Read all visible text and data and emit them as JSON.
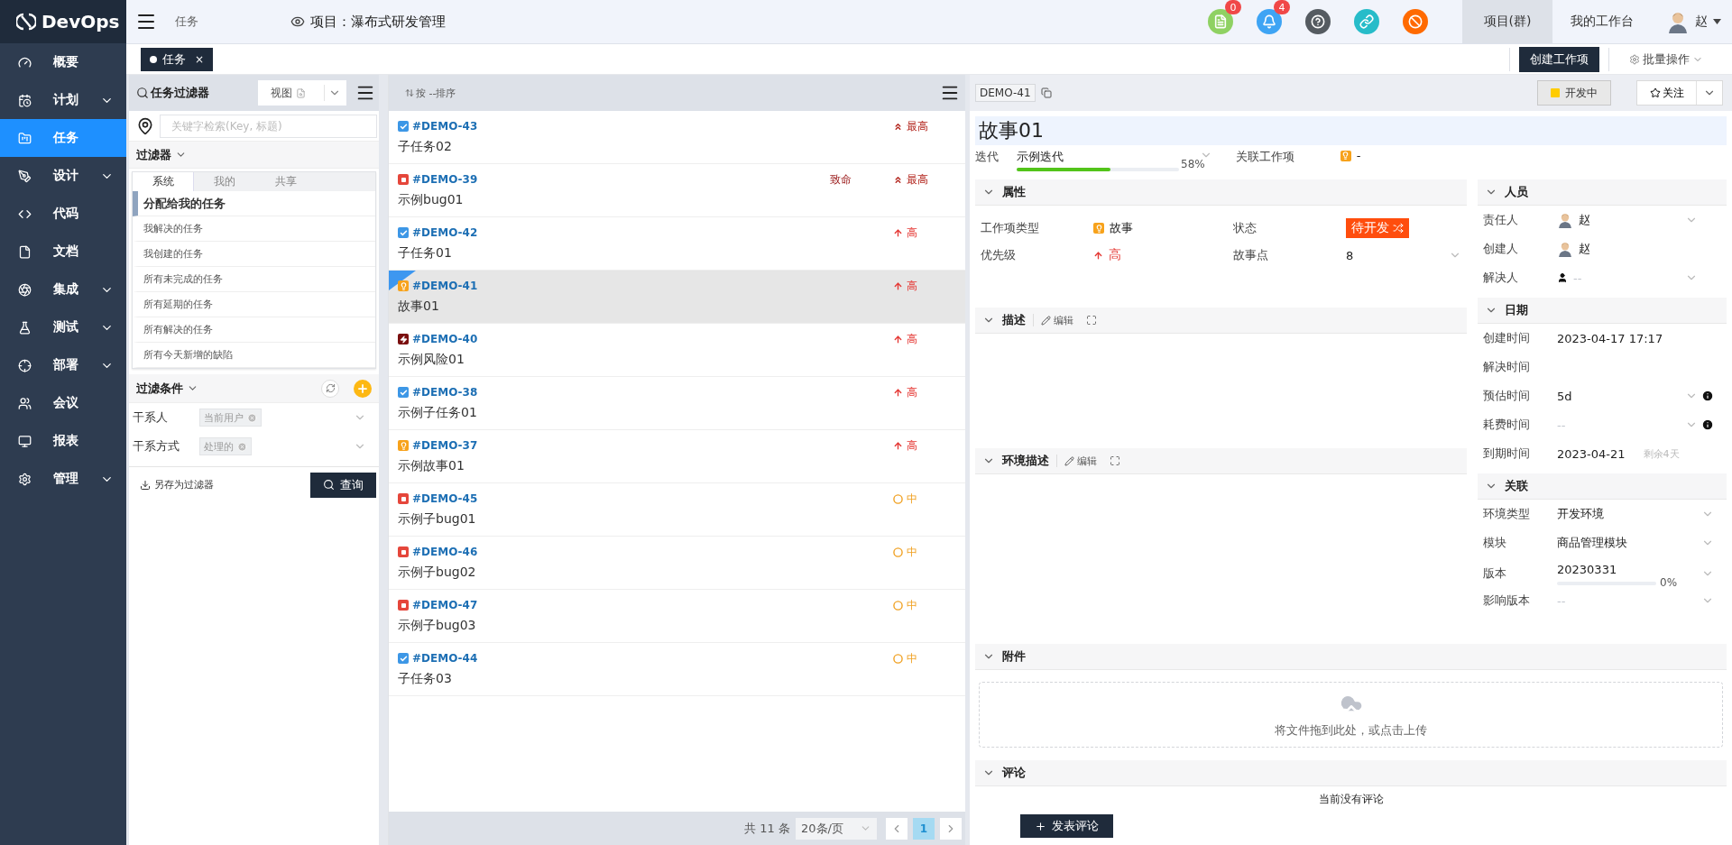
{
  "sidebar": {
    "logo": "DevOps",
    "items": [
      {
        "label": "概要",
        "selected": false,
        "expandable": false
      },
      {
        "label": "计划",
        "selected": false,
        "expandable": true
      },
      {
        "label": "任务",
        "selected": true,
        "expandable": false
      },
      {
        "label": "设计",
        "selected": false,
        "expandable": true
      },
      {
        "label": "代码",
        "selected": false,
        "expandable": false
      },
      {
        "label": "文档",
        "selected": false,
        "expandable": false
      },
      {
        "label": "集成",
        "selected": false,
        "expandable": true
      },
      {
        "label": "测试",
        "selected": false,
        "expandable": true
      },
      {
        "label": "部署",
        "selected": false,
        "expandable": true
      },
      {
        "label": "会议",
        "selected": false,
        "expandable": false
      },
      {
        "label": "报表",
        "selected": false,
        "expandable": false
      },
      {
        "label": "管理",
        "selected": false,
        "expandable": true
      }
    ]
  },
  "topbar": {
    "page": "任务",
    "project": "项目：瀑布式研发管理",
    "tools": [
      {
        "kind": "doc",
        "color": "#8fd163",
        "badge": "0"
      },
      {
        "kind": "bell",
        "color": "#3ea4f4",
        "badge": "4"
      },
      {
        "kind": "help",
        "color": "#555b61"
      },
      {
        "kind": "link",
        "color": "#27bcc9"
      },
      {
        "kind": "ban",
        "color": "#ff6a00"
      }
    ],
    "nav": [
      {
        "label": "项目(群)",
        "selected": true
      },
      {
        "label": "我的工作台",
        "selected": false
      }
    ],
    "user": "赵"
  },
  "tabs": [
    {
      "label": "任务",
      "selected": true,
      "close": "×"
    }
  ],
  "toolbar": {
    "create": "创建工作项",
    "batch": "批量操作"
  },
  "filter_panel": {
    "title": "任务过滤器",
    "view": "视图",
    "search": {
      "placeholder": "关键字检索(Key, 标题)"
    },
    "filters_title": "过滤器",
    "filters_expanded": true,
    "filter_tabs": [
      {
        "label": "系统",
        "selected": true
      },
      {
        "label": "我的",
        "selected": false
      },
      {
        "label": "共享",
        "selected": false
      }
    ],
    "filters": [
      {
        "label": "分配给我的任务",
        "selected": true
      },
      {
        "label": "我解决的任务",
        "selected": false
      },
      {
        "label": "我创建的任务",
        "selected": false
      },
      {
        "label": "所有未完成的任务",
        "selected": false
      },
      {
        "label": "所有延期的任务",
        "selected": false
      },
      {
        "label": "所有解决的任务",
        "selected": false
      },
      {
        "label": "所有今天新增的缺陷",
        "selected": false
      }
    ],
    "conditions_title": "过滤条件",
    "conditions_expanded": true,
    "conditions": [
      {
        "label": "干系人",
        "tag": "当前用户"
      },
      {
        "label": "干系方式",
        "tag": "处理的"
      }
    ],
    "save": "另存为过滤器",
    "query": "查询"
  },
  "list": {
    "sort": "按 --排序",
    "rows": [
      {
        "key": "#DEMO-43",
        "title": "子任务02",
        "kind": "task",
        "priority": {
          "label": "最高",
          "kind": "highest"
        },
        "selected": false
      },
      {
        "key": "#DEMO-39",
        "title": "示例bug01",
        "kind": "bug",
        "severity": "致命",
        "priority": {
          "label": "最高",
          "kind": "highest"
        },
        "selected": false
      },
      {
        "key": "#DEMO-42",
        "title": "子任务01",
        "kind": "task",
        "priority": {
          "label": "高",
          "kind": "high"
        },
        "selected": false
      },
      {
        "key": "#DEMO-41",
        "title": "故事01",
        "kind": "story",
        "priority": {
          "label": "高",
          "kind": "high"
        },
        "selected": true
      },
      {
        "key": "#DEMO-40",
        "title": "示例风险01",
        "kind": "risk",
        "priority": {
          "label": "高",
          "kind": "high"
        },
        "selected": false
      },
      {
        "key": "#DEMO-38",
        "title": "示例子任务01",
        "kind": "task",
        "priority": {
          "label": "高",
          "kind": "high"
        },
        "selected": false
      },
      {
        "key": "#DEMO-37",
        "title": "示例故事01",
        "kind": "story",
        "priority": {
          "label": "高",
          "kind": "high"
        },
        "selected": false
      },
      {
        "key": "#DEMO-45",
        "title": "示例子bug01",
        "kind": "bug",
        "priority": {
          "label": "中",
          "kind": "medium"
        },
        "selected": false
      },
      {
        "key": "#DEMO-46",
        "title": "示例子bug02",
        "kind": "bug",
        "priority": {
          "label": "中",
          "kind": "medium"
        },
        "selected": false
      },
      {
        "key": "#DEMO-47",
        "title": "示例子bug03",
        "kind": "bug",
        "priority": {
          "label": "中",
          "kind": "medium"
        },
        "selected": false
      },
      {
        "key": "#DEMO-44",
        "title": "子任务03",
        "kind": "task",
        "priority": {
          "label": "中",
          "kind": "medium"
        },
        "selected": false
      }
    ],
    "footer": {
      "total": "共 11 条",
      "page_size": "20条/页",
      "pages": [
        {
          "label": "1",
          "selected": true
        }
      ]
    }
  },
  "detail": {
    "key": "DEMO-41",
    "status": "开发中",
    "follow": "关注",
    "title": "故事01",
    "iteration": {
      "label": "迭代",
      "value": "示例迭代",
      "level": 0.58,
      "reading": "58%"
    },
    "related": {
      "label": "关联工作项",
      "value": "-"
    },
    "attributes": {
      "title": "属性",
      "expanded": true,
      "fields": [
        {
          "label": "工作项类型",
          "kind": "type",
          "value": "故事"
        },
        {
          "label": "状态",
          "kind": "status",
          "value": "待开发"
        },
        {
          "label": "优先级",
          "kind": "priority",
          "value": "高"
        },
        {
          "label": "故事点",
          "kind": "select",
          "value": "8"
        }
      ]
    },
    "description": {
      "title": "描述",
      "expanded": true,
      "edit": "编辑"
    },
    "environment": {
      "title": "环境描述",
      "expanded": true,
      "edit": "编辑"
    },
    "people": {
      "title": "人员",
      "expanded": true,
      "rows": [
        {
          "label": "责任人",
          "kind": "avatar",
          "value": "赵",
          "dropdown": true
        },
        {
          "label": "创建人",
          "kind": "avatar",
          "value": "赵",
          "dropdown": false
        },
        {
          "label": "解决人",
          "kind": "person",
          "placeholder": "--",
          "dropdown": true
        }
      ]
    },
    "dates": {
      "title": "日期",
      "expanded": true,
      "rows": [
        {
          "label": "创建时间",
          "value": "2023-04-17 17:17",
          "dropdown": false,
          "info": false
        },
        {
          "label": "解决时间",
          "dropdown": false,
          "info": false
        },
        {
          "label": "预估时间",
          "value": "5d",
          "dropdown": true,
          "info": true
        },
        {
          "label": "耗费时间",
          "placeholder": "--",
          "dropdown": true,
          "info": true
        },
        {
          "label": "到期时间",
          "value": "2023-04-21",
          "note": "剩余4天",
          "dropdown": false,
          "info": false
        }
      ]
    },
    "relations": {
      "title": "关联",
      "expanded": true,
      "rows": [
        {
          "label": "环境类型",
          "value": "开发环境",
          "dropdown": true
        },
        {
          "label": "模块",
          "value": "商品管理模块",
          "dropdown": true
        },
        {
          "label": "版本",
          "value": "20230331",
          "dropdown": true,
          "level": 0,
          "reading": "0%"
        },
        {
          "label": "影响版本",
          "placeholder": "--",
          "dropdown": true
        }
      ]
    },
    "attachments": {
      "title": "附件",
      "expanded": true,
      "hint": "将文件拖到此处，或点击上传"
    },
    "comments": {
      "title": "评论",
      "expanded": true,
      "empty": "当前没有评论",
      "button": "发表评论"
    }
  }
}
